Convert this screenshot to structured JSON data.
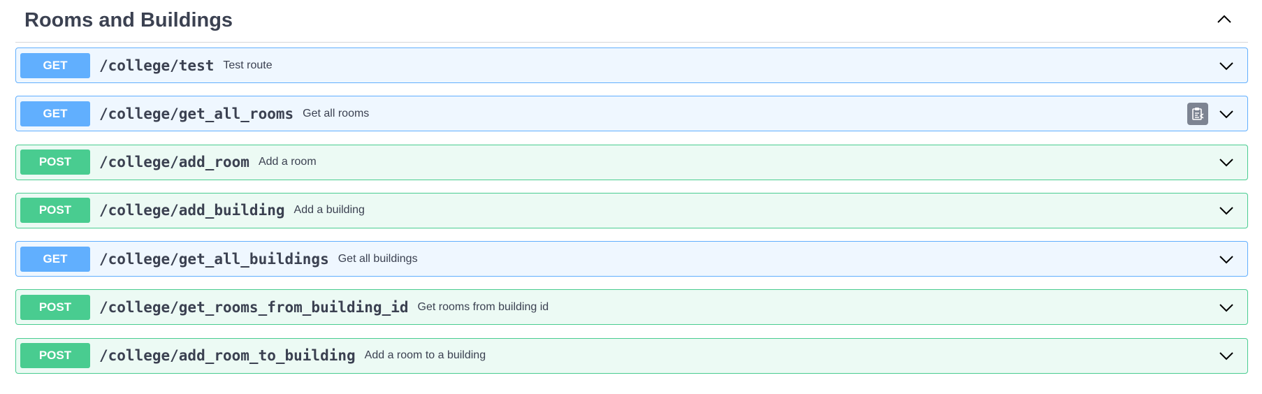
{
  "section": {
    "title": "Rooms and Buildings",
    "toggle_icon": "chevron-up-icon"
  },
  "colors": {
    "get": "#61affe",
    "post": "#49cc90",
    "text": "#3b4151",
    "copy_button": "#7d8492"
  },
  "operations": [
    {
      "method": "GET",
      "path": "/college/test",
      "summary": "Test route"
    },
    {
      "method": "GET",
      "path": "/college/get_all_rooms",
      "summary": "Get all rooms",
      "copy_icon": "copy-to-clipboard-icon"
    },
    {
      "method": "POST",
      "path": "/college/add_room",
      "summary": "Add a room"
    },
    {
      "method": "POST",
      "path": "/college/add_building",
      "summary": "Add a building"
    },
    {
      "method": "GET",
      "path": "/college/get_all_buildings",
      "summary": "Get all buildings"
    },
    {
      "method": "POST",
      "path": "/college/get_rooms_from_building_id",
      "summary": "Get rooms from building id"
    },
    {
      "method": "POST",
      "path": "/college/add_room_to_building",
      "summary": "Add a room to a building"
    }
  ]
}
